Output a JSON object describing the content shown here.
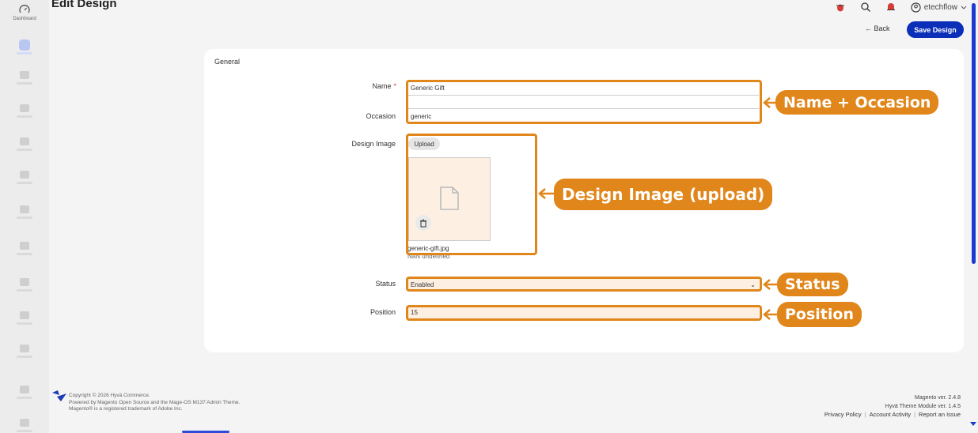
{
  "sidebar": {
    "dashboard_label": "Dashboard"
  },
  "header": {
    "title": "Edit Design",
    "user": "etechflow",
    "back_label": "← Back",
    "save_label": "Save Design"
  },
  "form": {
    "section": "General",
    "name_label": "Name",
    "name_value": "Generic Gift",
    "occasion_label": "Occasion",
    "occasion_value": "generic",
    "image_label": "Design Image",
    "upload_label": "Upload",
    "file_name": "generic-gift.jpg",
    "file_size": "NaN undefined",
    "status_label": "Status",
    "status_value": "Enabled",
    "position_label": "Position",
    "position_value": "15"
  },
  "callouts": {
    "name_occasion": "Name + Occasion",
    "design_image": "Design Image (upload)",
    "status": "Status",
    "position": "Position"
  },
  "footer": {
    "copyright": "Copyright © 2026 Hyvä Commerce.",
    "powered": "Powered by Magento Open Source and the Mage-OS M137 Admin Theme.",
    "trademark": "Magento® is a registered trademark of Adobe Inc.",
    "magento_ver": "Magento ver. 2.4.8",
    "hyva_ver": "Hyvä Theme Module ver. 1.4.5",
    "privacy": "Privacy Policy",
    "activity": "Account Activity",
    "report": "Report an Issue"
  },
  "colors": {
    "accent": "#e0861a",
    "primary": "#0b2fb8"
  }
}
